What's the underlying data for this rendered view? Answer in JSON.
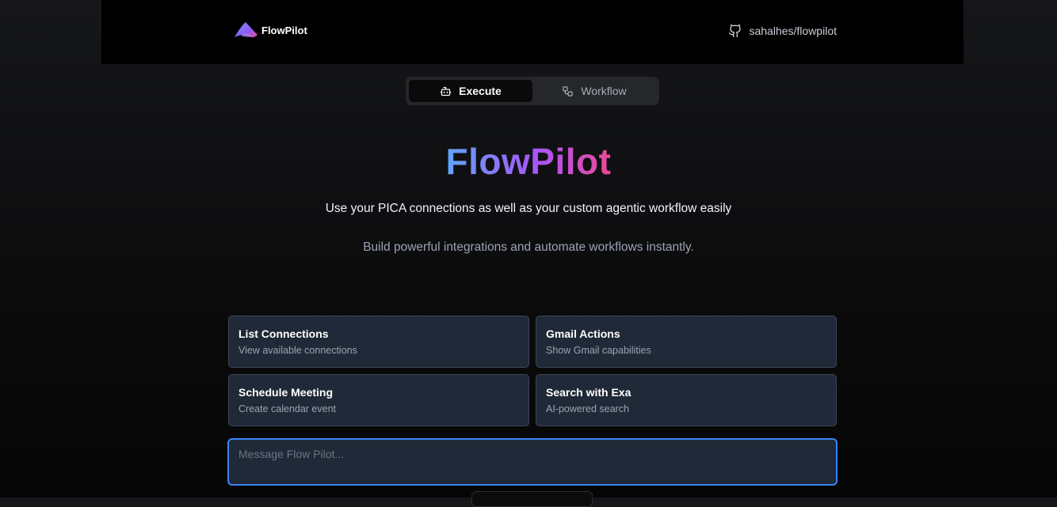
{
  "header": {
    "brand_name": "FlowPilot",
    "repo_label": "sahalhes/flowpilot",
    "logo_icon": "flowpilot-logo-icon",
    "repo_icon": "github-icon"
  },
  "mode_switch": {
    "tabs": [
      {
        "label": "Execute",
        "icon": "bot-icon",
        "active": true
      },
      {
        "label": "Workflow",
        "icon": "workflow-icon",
        "active": false
      }
    ]
  },
  "hero": {
    "title": "FlowPilot",
    "subtitle": "Use your PICA connections as well as your custom agentic workflow easily",
    "tagline": "Build powerful integrations and automate workflows instantly."
  },
  "suggestions": [
    {
      "title": "List Connections",
      "description": "View available connections"
    },
    {
      "title": "Gmail Actions",
      "description": "Show Gmail capabilities"
    },
    {
      "title": "Schedule Meeting",
      "description": "Create calendar event"
    },
    {
      "title": "Search with Exa",
      "description": "AI-powered search"
    }
  ],
  "composer": {
    "placeholder": "Message Flow Pilot...",
    "value": ""
  },
  "colors": {
    "accent": "#3b82f6",
    "gradient_start": "#60a5fa",
    "gradient_mid": "#a855f7",
    "gradient_end": "#ec4899",
    "card_bg": "#1f2937"
  }
}
